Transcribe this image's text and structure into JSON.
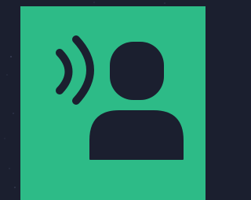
{
  "colors": {
    "background": "#1b1f2f",
    "tile": "#2dbb87",
    "glyph": "#1b1f2f"
  },
  "icon": {
    "name": "voice-user-icon",
    "parts": [
      "person-head",
      "person-body",
      "sound-wave-small",
      "sound-wave-large"
    ]
  }
}
